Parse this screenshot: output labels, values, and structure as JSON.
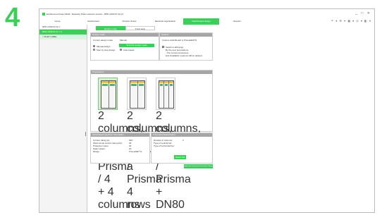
{
  "step_number": "4",
  "window": {
    "title": "EcoStruxure Power Build - Rapsody Draw customer service - RPD-AXDN-6 b2.rpf",
    "controls": "_ □ ✕"
  },
  "menu": {
    "tabs": [
      "Home",
      "Switchboard",
      "Product choice",
      "Electrical organization",
      "Switchboard design",
      "Reports"
    ],
    "active_tab": 4,
    "tools": "↶ ▾  ☰ ▾  ▦ ▾  ◎ ▾  ◧ ▾"
  },
  "sidebar": {
    "header": "RPD-AXDN-6 b2 1",
    "items": [
      {
        "label": "RPD-AXDN-6 b2 1 0",
        "state": "selected"
      },
      {
        "label": "> FILET LABEL",
        "state": "sub"
      }
    ]
  },
  "subtabs": [
    "Design mode",
    "Front view"
  ],
  "active_subtab": 0,
  "design_mode": {
    "header": "Design mode",
    "current_label": "Current design mode",
    "current_value": "Manual",
    "options": [
      "Manual design",
      "Step by step design",
      "Auto-based"
    ],
    "apply_button": "Start the design mode"
  },
  "options_panel": {
    "header": "Options",
    "intro": "Custom switchboard is Prisma/ESTS",
    "checkbox": "Switch to Eff range",
    "lines": [
      "By the next propositions:",
      "- The current enclosures",
      "and installation systems will be deleted."
    ]
  },
  "propositions": {
    "header": "Propositions",
    "cards": [
      "2 columns, 2 columns Prisma / 4 + 4 columns - DN80 / 6...",
      "2 columns, 1 columns / Prisma 4 rows - DN80",
      "2 columns, 2 columns / Prisma + DN80 / 6 columns..."
    ],
    "selected_card": 0
  },
  "summary": {
    "header": "Switchboard selection information",
    "rows": [
      {
        "label": "Current rating (A):",
        "value": "630"
      },
      {
        "label": "Short-circuit current rating (kA):",
        "value": "36"
      },
      {
        "label": "Protection index:",
        "value": "30"
      },
      {
        "label": "Spare space:",
        "value": "20"
      },
      {
        "label": "Range:",
        "value": "PrismaSET G"
      }
    ]
  },
  "characteristics": {
    "header": "Proposal characteristics",
    "rows": [
      {
        "label": "Number of columns:",
        "value": "2"
      },
      {
        "label": "Type of vertical bar:",
        "value": ""
      },
      {
        "label": "Type of horizontal bar:",
        "value": ""
      }
    ],
    "select_button": "Select this"
  },
  "footer_button": "Apply selected proposal and continue design",
  "colors": {
    "accent": "#3dcd58",
    "panel_header": "#a6a6a6",
    "selected_card": "#d8f0d0"
  }
}
